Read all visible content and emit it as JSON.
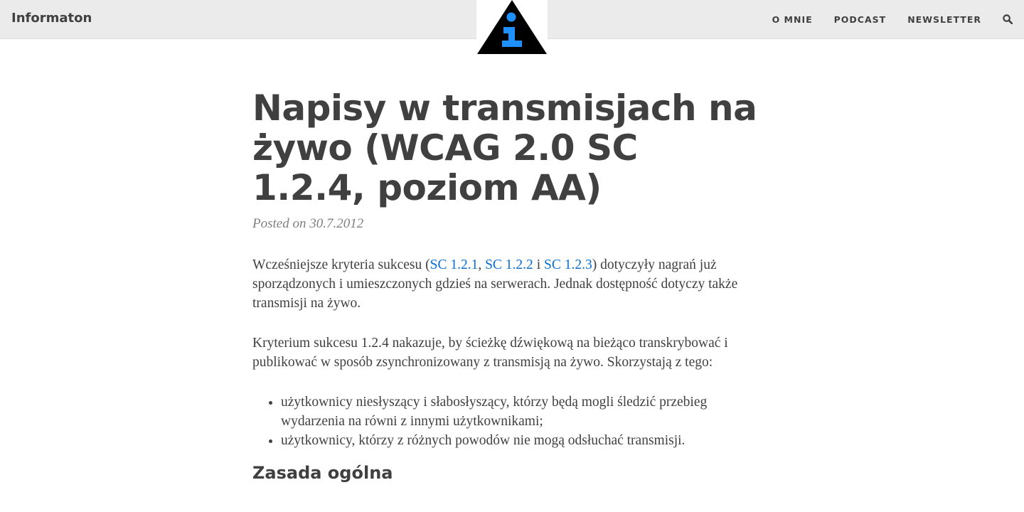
{
  "header": {
    "brand": "Informaton",
    "nav": [
      "O MNIE",
      "PODCAST",
      "NEWSLETTER"
    ],
    "search_icon": "search-icon",
    "logo_icon": "info-triangle-logo",
    "colors": {
      "bar": "#ebebeb",
      "logo_triangle": "#000000",
      "logo_letter": "#1e90ff"
    }
  },
  "post": {
    "title": "Napisy w transmisjach na żywo (WCAG 2.0 SC 1.2.4, poziom AA)",
    "posted_on_label": "Posted on",
    "date": "30.7.2012",
    "p1": {
      "before": "Wcześniejsze kryteria sukcesu (",
      "link1": "SC 1.2.1",
      "sep1": ", ",
      "link2": "SC 1.2.2",
      "sep2": " i ",
      "link3": "SC 1.2.3",
      "after": ") dotyczyły nagrań już sporządzonych i umieszczonych gdzieś na serwerach. Jednak dostępność dotyczy także transmisji na żywo."
    },
    "p2": "Kryterium sukcesu 1.2.4 nakazuje, by ścieżkę dźwiękową na bieżąco transkrybować i publikować w sposób zsynchronizowany z transmisją na żywo. Skorzystają z tego:",
    "list": [
      "użytkownicy niesłyszący i słabosłyszący, którzy będą mogli śledzić przebieg wydarzenia na równi z innymi użytkownikami;",
      "użytkownicy, którzy z różnych powodów nie mogą odsłuchać transmisji."
    ],
    "h2": "Zasada ogólna",
    "link_color": "#0a6ed1"
  }
}
